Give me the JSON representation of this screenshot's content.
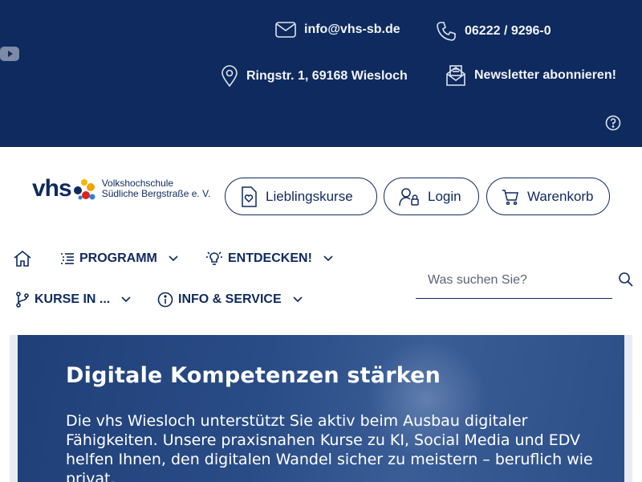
{
  "topbar": {
    "email": "info@vhs-sb.de",
    "phone": "06222 / 9296-0",
    "address": "Ringstr. 1, 69168 Wiesloch",
    "newsletter": "Newsletter abonnieren!",
    "colors": {
      "background": "#0e2a5e",
      "text": "#f2f4f8"
    }
  },
  "logo": {
    "brand": "vhs",
    "line1": "Volkshochschule",
    "line2": "Südliche Bergstraße e. V."
  },
  "actions": {
    "favorites": "Lieblingskurse",
    "login": "Login",
    "cart": "Warenkorb"
  },
  "nav": {
    "home_icon": "home-icon",
    "items": [
      {
        "label": "PROGRAMM",
        "icon": "list-icon"
      },
      {
        "label": "ENTDECKEN!",
        "icon": "lightbulb-icon"
      },
      {
        "label": "KURSE IN ...",
        "icon": "branch-icon"
      },
      {
        "label": "INFO & SERVICE",
        "icon": "info-icon"
      }
    ]
  },
  "search": {
    "placeholder": "Was suchen Sie?"
  },
  "hero": {
    "title": "Digitale Kompetenzen stärken",
    "text": "Die vhs Wiesloch unterstützt Sie aktiv beim Ausbau digitaler Fähigkeiten. Unsere praxisnahen Kurse zu KI, Social Media und EDV helfen Ihnen, den digitalen Wandel sicher zu meistern – beruflich wie privat."
  }
}
